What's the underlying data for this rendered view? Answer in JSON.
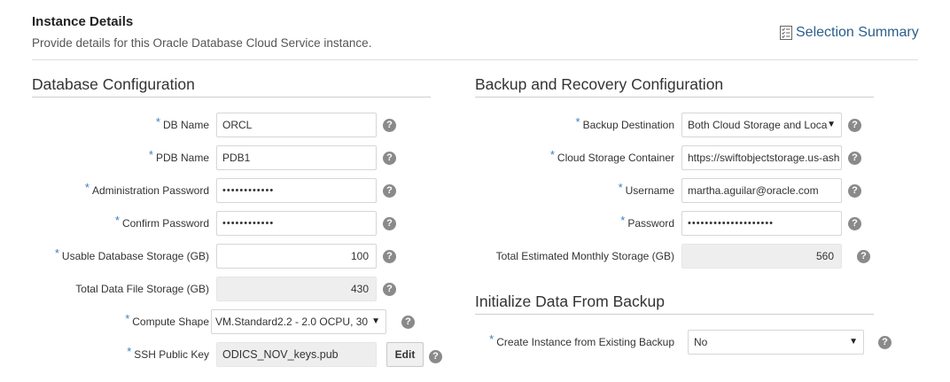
{
  "header": {
    "title": "Instance Details",
    "subtitle": "Provide details for this Oracle Database Cloud Service instance.",
    "summary_label": "Selection Summary",
    "summary_icon": "checklist-icon"
  },
  "required_marker": "*",
  "help_glyph": "?",
  "db_config": {
    "title": "Database Configuration",
    "db_name": {
      "label": "DB Name",
      "value": "ORCL"
    },
    "pdb_name": {
      "label": "PDB Name",
      "value": "PDB1"
    },
    "admin_password": {
      "label": "Administration Password",
      "value": "••••••••••••"
    },
    "confirm_password": {
      "label": "Confirm Password",
      "value": "••••••••••••"
    },
    "usable_storage": {
      "label": "Usable Database Storage (GB)",
      "value": "100"
    },
    "total_storage": {
      "label": "Total Data File Storage (GB)",
      "value": "430"
    },
    "compute_shape": {
      "label": "Compute Shape",
      "value": "VM.Standard2.2 - 2.0 OCPU, 30"
    },
    "ssh_key": {
      "label": "SSH Public Key",
      "value": "ODICS_NOV_keys.pub",
      "edit_label": "Edit"
    }
  },
  "backup_config": {
    "title": "Backup and Recovery Configuration",
    "destination": {
      "label": "Backup Destination",
      "value": "Both Cloud Storage and Loca"
    },
    "container": {
      "label": "Cloud Storage Container",
      "value": "https://swiftobjectstorage.us-ash"
    },
    "username": {
      "label": "Username",
      "value": "martha.aguilar@oracle.com"
    },
    "password": {
      "label": "Password",
      "value": "••••••••••••••••••••"
    },
    "monthly_storage": {
      "label": "Total Estimated Monthly Storage (GB)",
      "value": "560"
    }
  },
  "init_backup": {
    "title": "Initialize Data From Backup",
    "create_from_backup": {
      "label": "Create Instance from Existing Backup",
      "value": "No"
    }
  },
  "colors": {
    "link": "#2c5f8a",
    "required": "#3b7fbf",
    "help": "#8a8a8a"
  }
}
